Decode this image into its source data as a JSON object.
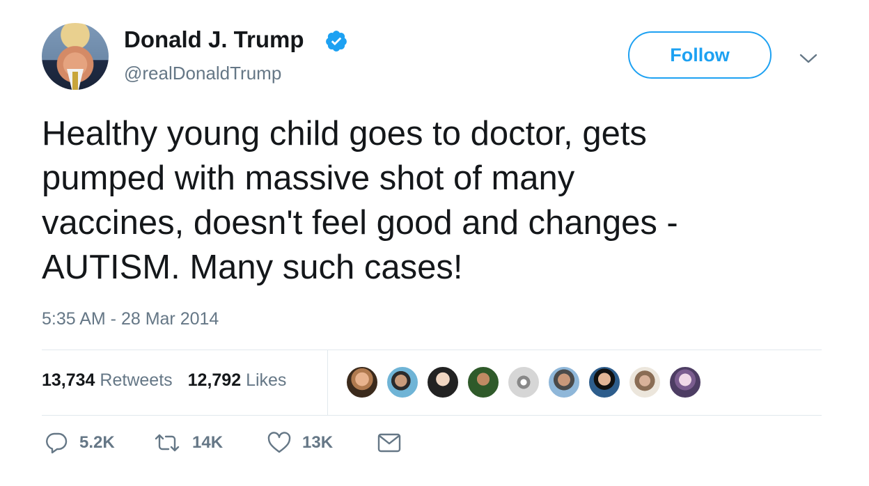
{
  "author": {
    "name": "Donald J. Trump",
    "handle": "@realDonaldTrump",
    "verified_icon": "verified-badge-icon"
  },
  "header": {
    "follow_label": "Follow",
    "menu_icon": "chevron-down-icon"
  },
  "tweet": {
    "text": "Healthy young child goes to doctor, gets\npumped with massive shot of many\nvaccines, doesn't feel good and changes -\nAUTISM. Many such cases!",
    "timestamp": "5:35 AM - 28 Mar 2014"
  },
  "stats": {
    "retweets_count": "13,734",
    "retweets_label": "Retweets",
    "likes_count": "12,792",
    "likes_label": "Likes"
  },
  "likers": {
    "count_shown": 9
  },
  "actions": {
    "reply_count": "5.2K",
    "retweet_count": "14K",
    "like_count": "13K",
    "dm_icon": "envelope-icon"
  },
  "colors": {
    "accent": "#1da1f2",
    "text_primary": "#14171a",
    "text_secondary": "#657786",
    "divider": "#e1e8ed"
  }
}
